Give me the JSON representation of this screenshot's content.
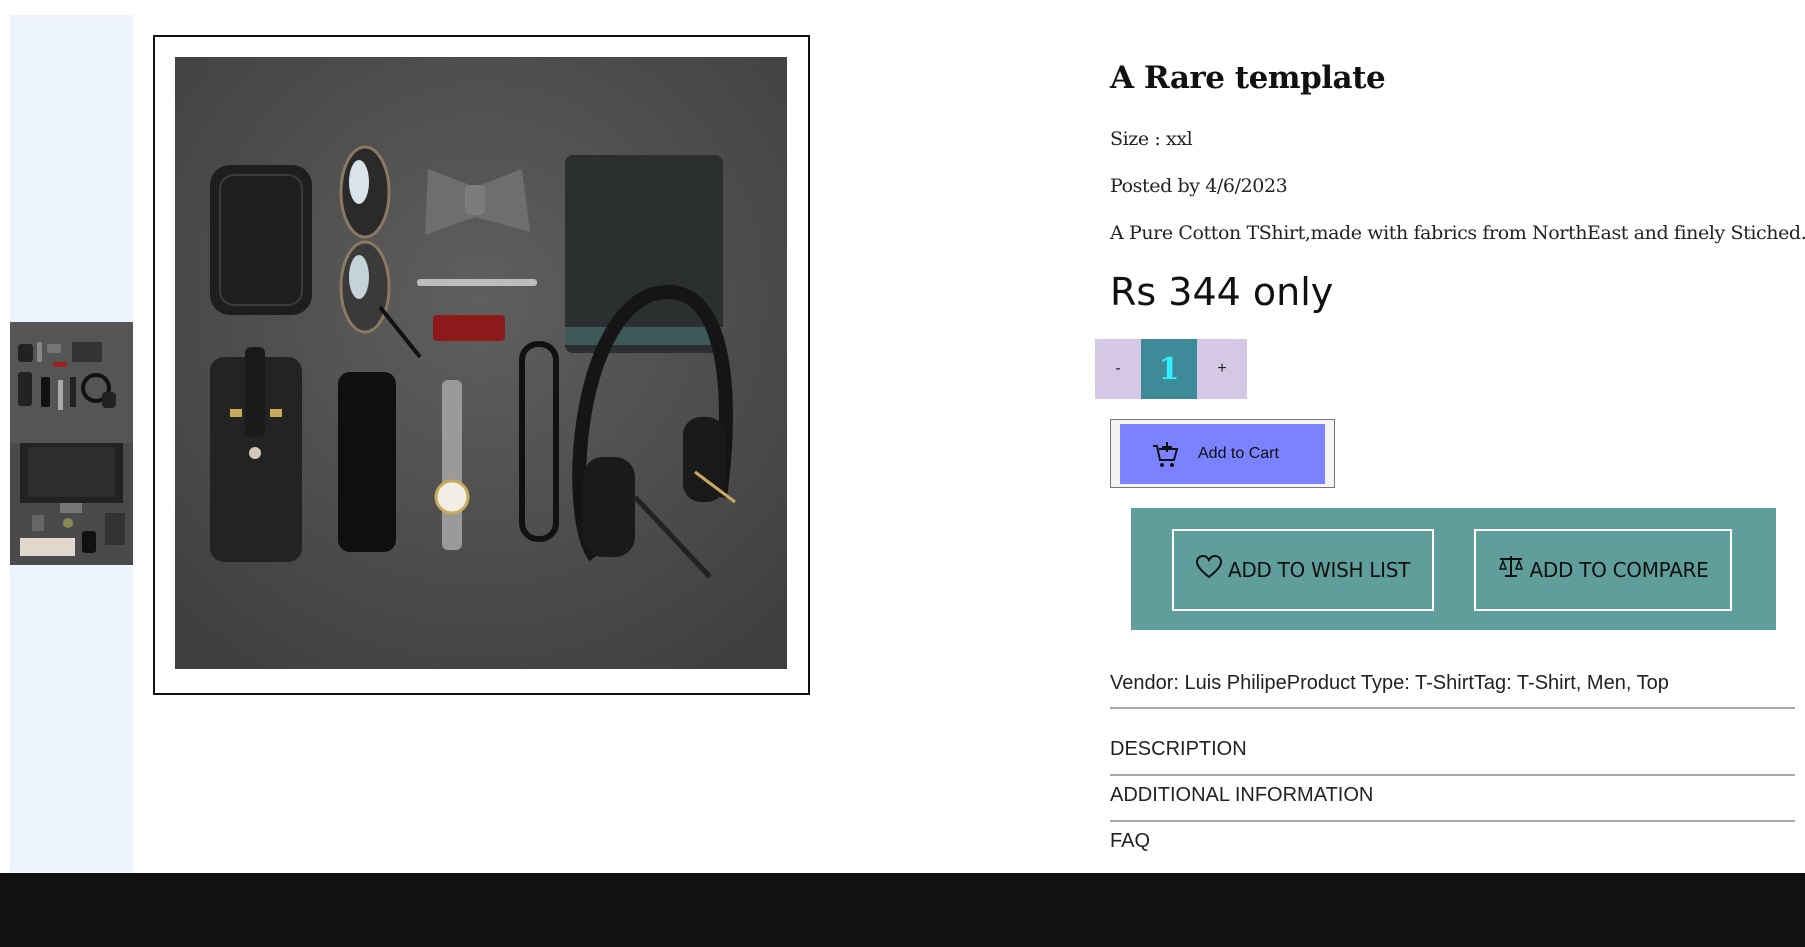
{
  "product": {
    "title": "A Rare template",
    "size": "Size : xxl",
    "posted": "Posted by 4/6/2023",
    "description": "A Pure Cotton TShirt,made with fabrics from NorthEast and finely Stiched.",
    "price": "Rs 344 only"
  },
  "quantity": {
    "decrement_label": "-",
    "value": "1",
    "increment_label": "+"
  },
  "cart": {
    "add_label": "Add to Cart",
    "icon": "cart-plus-icon"
  },
  "actions": {
    "wishlist_label": "ADD TO WISH LIST",
    "wishlist_icon": "heart-icon",
    "compare_label": "ADD TO COMPARE",
    "compare_icon": "scale-icon"
  },
  "meta_line": "Vendor: Luis PhilipeProduct Type: T-ShirtTag: T-Shirt, Men, Top",
  "accordion": [
    "DESCRIPTION",
    "ADDITIONAL INFORMATION",
    "FAQ"
  ],
  "colors": {
    "thumb_rail": "#eef5ff",
    "qty_buttons": "#d5c8e5",
    "qty_value_bg": "#3d8a99",
    "qty_value_text": "#2ef0ff",
    "cart_button": "#7a82ff",
    "action_panel": "#5f9e9b",
    "footer": "#111111"
  }
}
